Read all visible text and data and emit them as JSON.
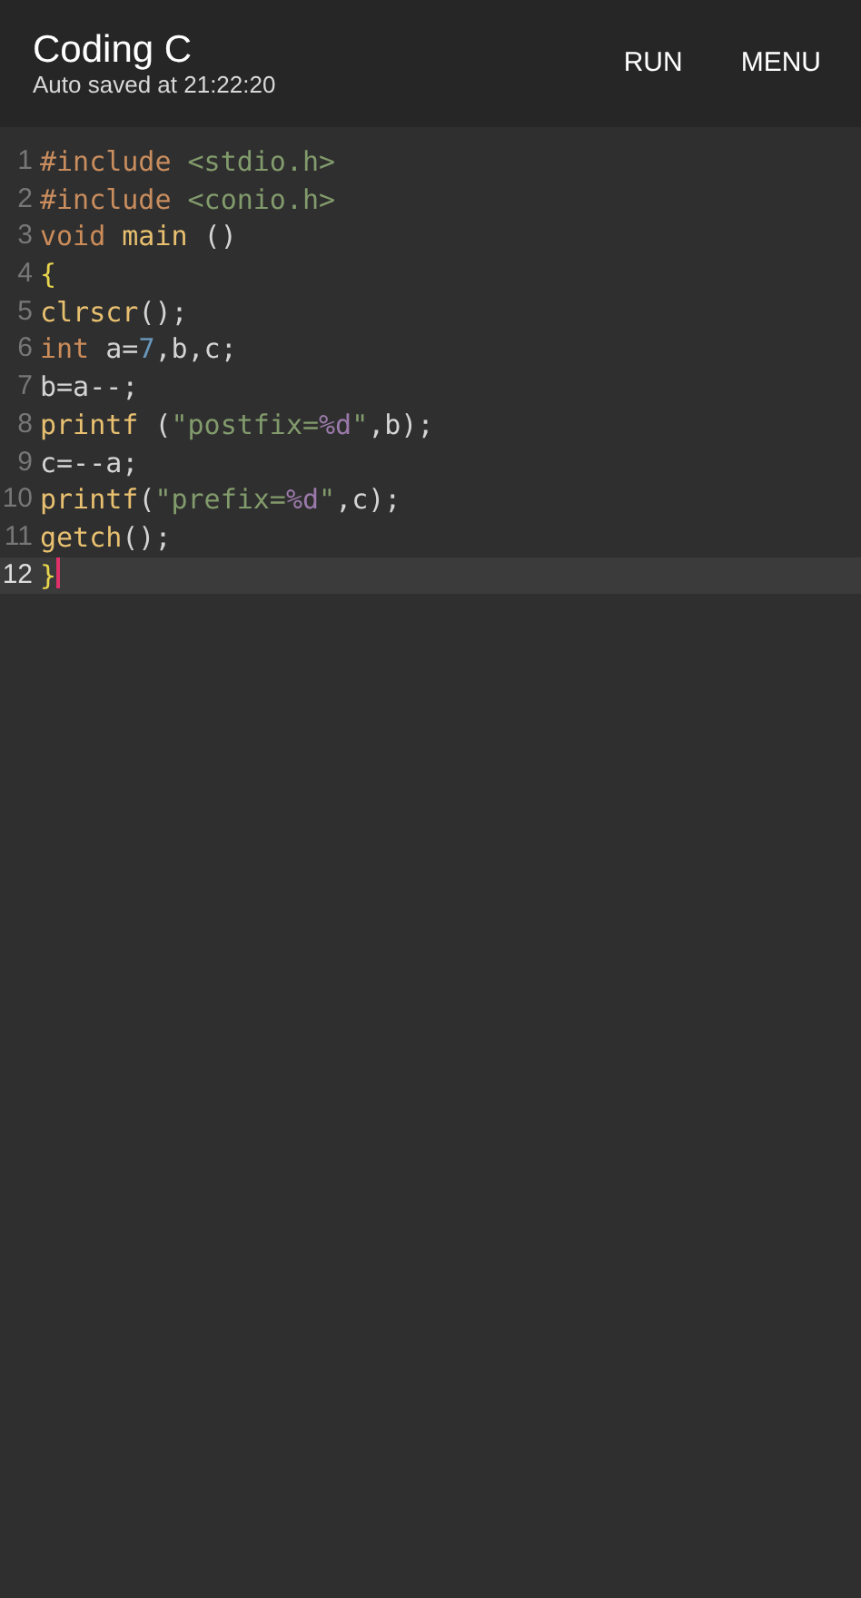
{
  "app_bar": {
    "title": "Coding C",
    "subtitle": "Auto saved at 21:22:20",
    "actions": [
      "RUN",
      "MENU"
    ]
  },
  "editor": {
    "lines": [
      {
        "number": "1",
        "current": false,
        "tokens": [
          {
            "kind": "preproc",
            "text": "#include "
          },
          {
            "kind": "string",
            "text": "<stdio.h>"
          }
        ]
      },
      {
        "number": "2",
        "current": false,
        "tokens": [
          {
            "kind": "preproc",
            "text": "#include "
          },
          {
            "kind": "string",
            "text": "<conio.h>"
          }
        ]
      },
      {
        "number": "3",
        "current": false,
        "tokens": [
          {
            "kind": "keyword",
            "text": "void "
          },
          {
            "kind": "function",
            "text": "main"
          },
          {
            "kind": "plain",
            "text": " ()"
          }
        ]
      },
      {
        "number": "4",
        "current": false,
        "tokens": [
          {
            "kind": "brace",
            "text": "{"
          }
        ]
      },
      {
        "number": "5",
        "current": false,
        "tokens": [
          {
            "kind": "function",
            "text": "clrscr"
          },
          {
            "kind": "plain",
            "text": "();"
          }
        ]
      },
      {
        "number": "6",
        "current": false,
        "tokens": [
          {
            "kind": "keyword",
            "text": "int"
          },
          {
            "kind": "plain",
            "text": " a="
          },
          {
            "kind": "number",
            "text": "7"
          },
          {
            "kind": "plain",
            "text": ",b,c;"
          }
        ]
      },
      {
        "number": "7",
        "current": false,
        "tokens": [
          {
            "kind": "plain",
            "text": "b=a--;"
          }
        ]
      },
      {
        "number": "8",
        "current": false,
        "tokens": [
          {
            "kind": "function",
            "text": "printf"
          },
          {
            "kind": "plain",
            "text": " ("
          },
          {
            "kind": "string",
            "text": "\"postfix="
          },
          {
            "kind": "format",
            "text": "%d"
          },
          {
            "kind": "string",
            "text": "\""
          },
          {
            "kind": "plain",
            "text": ",b);"
          }
        ]
      },
      {
        "number": "9",
        "current": false,
        "tokens": [
          {
            "kind": "plain",
            "text": "c=--a;"
          }
        ]
      },
      {
        "number": "10",
        "current": false,
        "tokens": [
          {
            "kind": "function",
            "text": "printf"
          },
          {
            "kind": "plain",
            "text": "("
          },
          {
            "kind": "string",
            "text": "\"prefix="
          },
          {
            "kind": "format",
            "text": "%d"
          },
          {
            "kind": "string",
            "text": "\""
          },
          {
            "kind": "plain",
            "text": ",c);"
          }
        ]
      },
      {
        "number": "11",
        "current": false,
        "tokens": [
          {
            "kind": "function",
            "text": "getch"
          },
          {
            "kind": "plain",
            "text": "();"
          }
        ]
      },
      {
        "number": "12",
        "current": true,
        "tokens": [
          {
            "kind": "brace",
            "text": "}"
          }
        ]
      }
    ]
  }
}
